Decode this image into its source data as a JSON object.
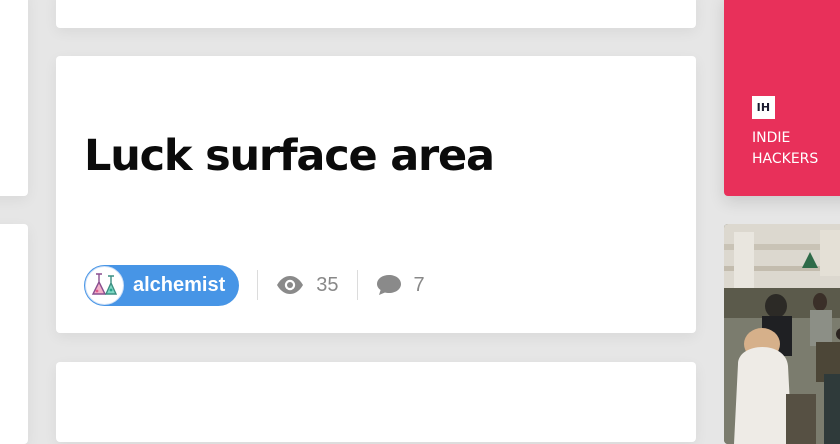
{
  "post": {
    "title": "Luck surface area",
    "author": "alchemist",
    "views": "35",
    "comments": "7"
  },
  "promo": {
    "logo_text": "IH",
    "line1": "INDIE",
    "line2": "HACKERS"
  },
  "icons": {
    "views": "eye-icon",
    "comments": "speech-bubble-icon"
  },
  "colors": {
    "author_pill": "#4795e6",
    "promo_background": "#e8305a",
    "page_background": "#e6e6e6"
  }
}
